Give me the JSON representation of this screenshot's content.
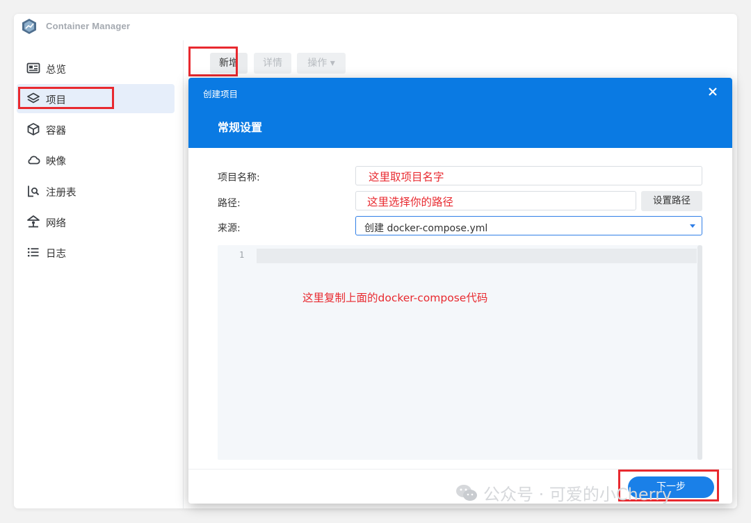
{
  "app": {
    "title": "Container Manager"
  },
  "sidebar": {
    "items": [
      {
        "label": "总览",
        "icon": "overview-icon"
      },
      {
        "label": "项目",
        "icon": "layers-icon",
        "active": true
      },
      {
        "label": "容器",
        "icon": "cube-icon"
      },
      {
        "label": "映像",
        "icon": "cloud-icon"
      },
      {
        "label": "注册表",
        "icon": "registry-search-icon"
      },
      {
        "label": "网络",
        "icon": "network-icon"
      },
      {
        "label": "日志",
        "icon": "list-icon"
      }
    ]
  },
  "toolbar": {
    "new_label": "新增",
    "details_label": "详情",
    "actions_label": "操作 ▾"
  },
  "dialog": {
    "title": "创建项目",
    "step_title": "常规设置",
    "form": {
      "name_label": "项目名称:",
      "name_note": "这里取项目名字",
      "path_label": "路径:",
      "path_note": "这里选择你的路径",
      "path_button": "设置路径",
      "source_label": "来源:",
      "source_value": "创建 docker-compose.yml"
    },
    "editor": {
      "line_number": "1",
      "note": "这里复制上面的docker-compose代码"
    },
    "next_button": "下一步"
  },
  "watermark": {
    "text": "公众号 · 可爱的小Cherry"
  },
  "colors": {
    "accent": "#0a7ae3",
    "highlight": "#e8292f",
    "active_nav": "#e6eefa"
  }
}
